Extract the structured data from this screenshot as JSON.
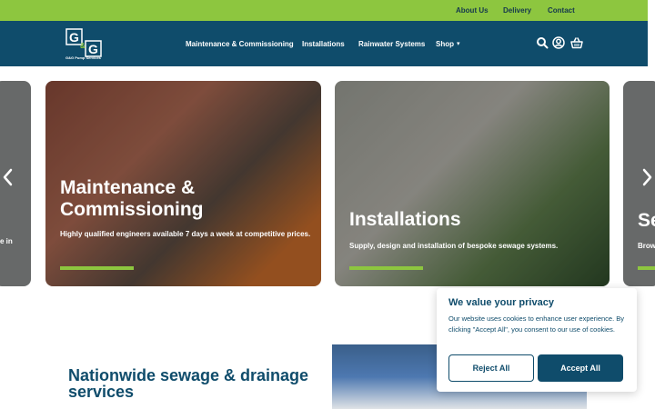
{
  "topbar": {
    "links": [
      "About Us",
      "Delivery",
      "Contact"
    ]
  },
  "brand": {
    "logo_text": "G&G Pump Services",
    "logo_letters": "G G",
    "colors": {
      "green": "#8dc63f",
      "navy": "#0f4c6b"
    }
  },
  "nav": {
    "links": [
      "Maintenance & Commissioning",
      "Installations",
      "Rainwater Systems",
      "Shop"
    ],
    "icons": [
      "search-icon",
      "account-icon",
      "basket-icon"
    ]
  },
  "carousel": {
    "left_fragment": "e in",
    "cards": [
      {
        "title": "Maintenance & Commissioning",
        "desc": "Highly qualified engineers available 7 days a week at competitive prices."
      },
      {
        "title": "Installations",
        "desc": "Supply, design and installation of bespoke sewage systems."
      }
    ],
    "right_fragment": {
      "title": "Se",
      "desc": "Brow"
    }
  },
  "section": {
    "title": "Nationwide sewage & drainage services"
  },
  "cookie": {
    "title": "We value your privacy",
    "text": "Our website uses cookies to enhance user experience. By clicking \"Accept All\", you consent to our use of cookies.",
    "reject_label": "Reject All",
    "accept_label": "Accept All"
  }
}
